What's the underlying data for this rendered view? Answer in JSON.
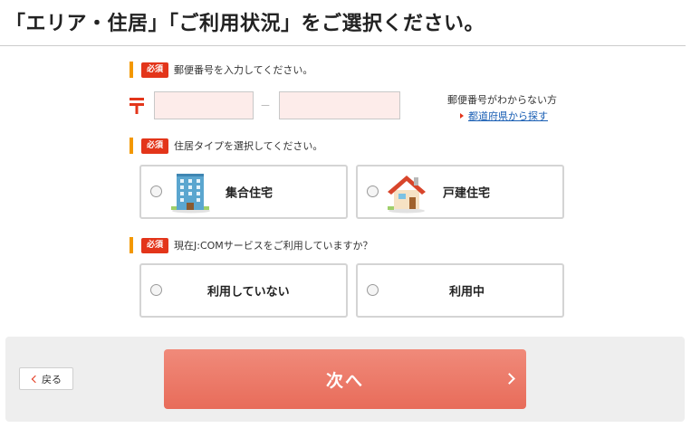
{
  "page_title": "「エリア・住居」「ご利用状況」をご選択ください。",
  "required_badge": "必須",
  "postal": {
    "label": "郵便番号を入力してください。",
    "first_value": "",
    "second_value": "",
    "dash": "－",
    "help_text": "郵便番号がわからない方",
    "link_text": "都道府県から探す"
  },
  "housing": {
    "label": "住居タイプを選択してください。",
    "options": [
      {
        "label": "集合住宅",
        "icon": "apartment-icon"
      },
      {
        "label": "戸建住宅",
        "icon": "house-icon"
      }
    ]
  },
  "usage": {
    "label": "現在J:COMサービスをご利用していますか？",
    "options": [
      {
        "label": "利用していない"
      },
      {
        "label": "利用中"
      }
    ]
  },
  "footer": {
    "back_label": "戻る",
    "next_label": "次へ"
  },
  "colors": {
    "accent_red": "#e3351a",
    "marker_orange": "#f39800",
    "next_button": "#e86c5a",
    "input_fill": "#fdecea",
    "link_blue": "#1a5fb4"
  }
}
